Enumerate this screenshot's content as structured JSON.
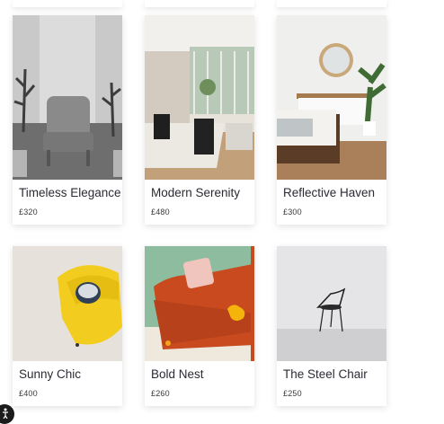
{
  "products": [
    {
      "name": "Timeless Elegance",
      "price": "£320",
      "image": "grey-armchair-photo"
    },
    {
      "name": "Modern Serenity",
      "price": "£480",
      "image": "living-room-photo"
    },
    {
      "name": "Reflective Haven",
      "price": "£300",
      "image": "bedroom-mirror-photo"
    },
    {
      "name": "Sunny Chic",
      "price": "£400",
      "image": "yellow-armchair-photo"
    },
    {
      "name": "Bold Nest",
      "price": "£260",
      "image": "orange-sofa-photo"
    },
    {
      "name": "The Steel Chair",
      "price": "£250",
      "image": "steel-chair-photo"
    }
  ]
}
